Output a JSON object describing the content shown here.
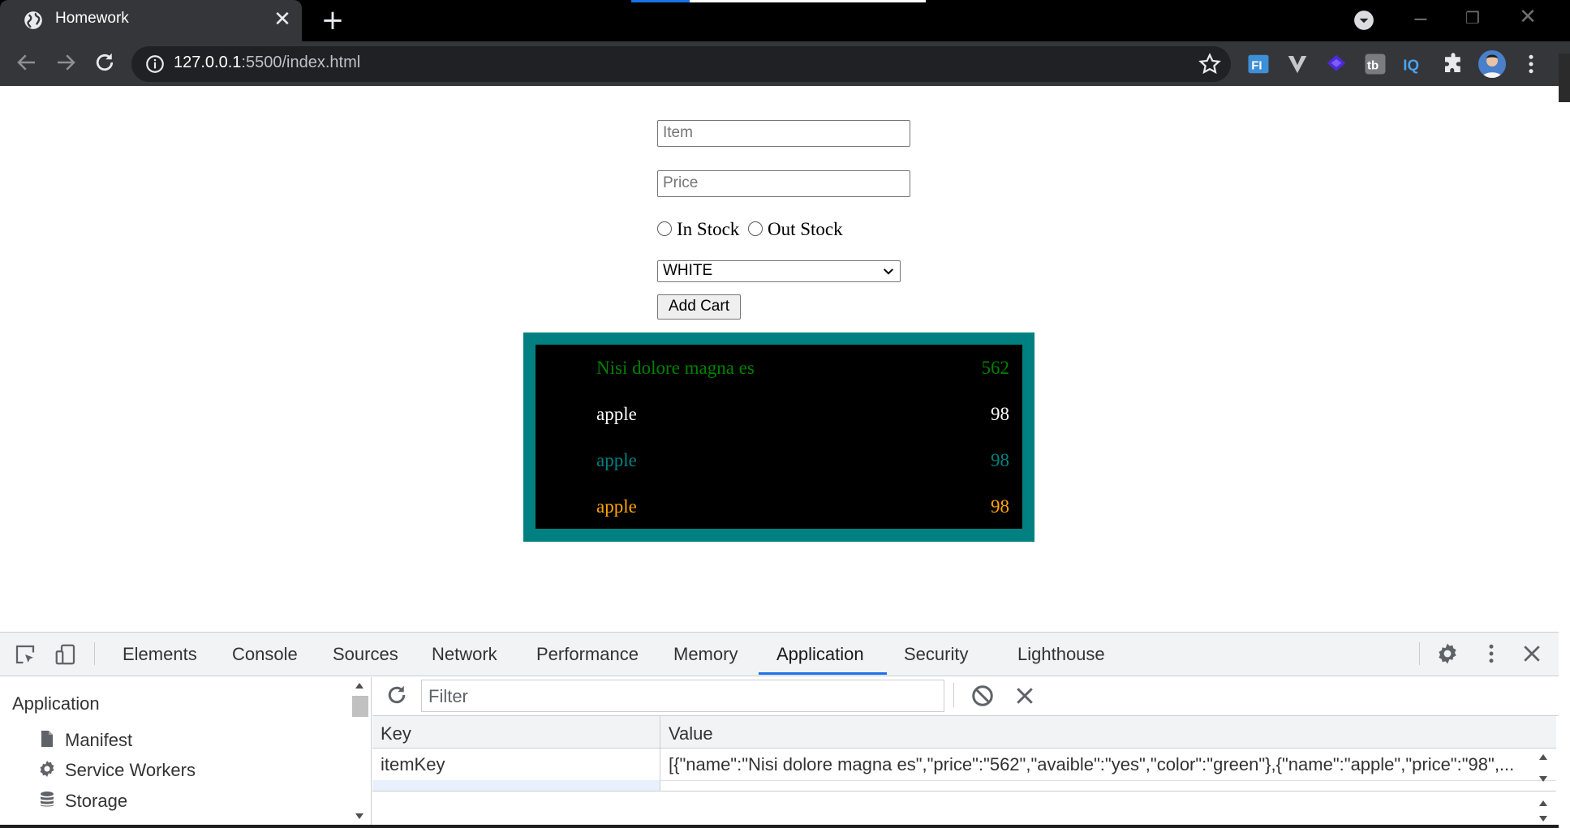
{
  "browser": {
    "tab_title": "Homework",
    "url_host": "127.0.0.1",
    "url_rest": ":5500/index.html"
  },
  "form": {
    "item_placeholder": "Item",
    "price_placeholder": "Price",
    "radio_in_label": "In Stock",
    "radio_out_label": "Out Stock",
    "color_selected": "WHITE",
    "add_button": "Add Cart"
  },
  "cart": {
    "border_color": "#008080",
    "items": [
      {
        "name": "Nisi dolore magna es",
        "price": "562",
        "color": "#008000"
      },
      {
        "name": "apple",
        "price": "98",
        "color": "#ffffff"
      },
      {
        "name": "apple",
        "price": "98",
        "color": "#008080"
      },
      {
        "name": "apple",
        "price": "98",
        "color": "#ffa500"
      }
    ]
  },
  "devtools": {
    "tabs": [
      "Elements",
      "Console",
      "Sources",
      "Network",
      "Performance",
      "Memory",
      "Application",
      "Security",
      "Lighthouse"
    ],
    "active_tab": "Application",
    "sidebar": {
      "heading": "Application",
      "items": [
        "Manifest",
        "Service Workers",
        "Storage"
      ]
    },
    "filter_placeholder": "Filter",
    "table": {
      "headers": [
        "Key",
        "Value"
      ],
      "rows": [
        {
          "key": "itemKey",
          "value": "[{\"name\":\"Nisi dolore magna es\",\"price\":\"562\",\"avaible\":\"yes\",\"color\":\"green\"},{\"name\":\"apple\",\"price\":\"98\",..."
        }
      ]
    }
  }
}
